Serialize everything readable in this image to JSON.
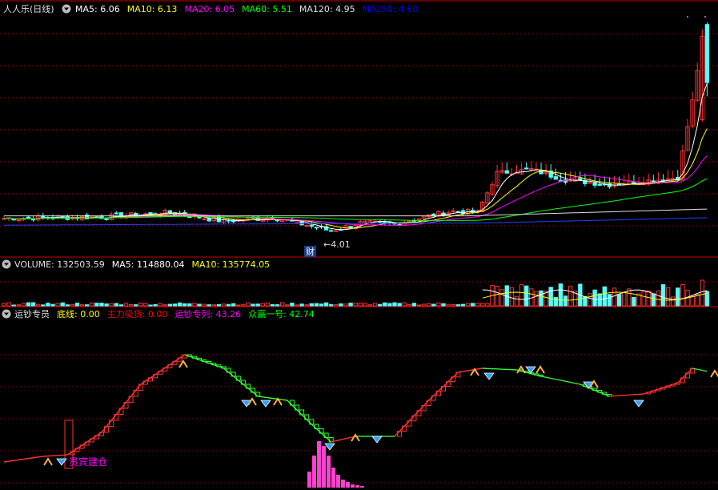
{
  "main_panel": {
    "title": "人人乐(日线)",
    "legend": [
      {
        "name": "MA5",
        "text": "MA5: 6.06",
        "color": "#ffffff"
      },
      {
        "name": "MA10",
        "text": "MA10: 6.13",
        "color": "#ffff00"
      },
      {
        "name": "MA20",
        "text": "MA20: 6.05",
        "color": "#ff00ff"
      },
      {
        "name": "MA60",
        "text": "MA60: 5.51",
        "color": "#00ff00"
      },
      {
        "name": "MA120",
        "text": "MA120: 4.95",
        "color": "#e0e0e0"
      },
      {
        "name": "MA250",
        "text": "MA250: 4.60",
        "color": "#0000ff"
      }
    ],
    "low_label": "←4.01",
    "finance_badge": "财"
  },
  "volume_panel": {
    "legend": [
      {
        "name": "VOLUME",
        "text": "VOLUME: 132503.59",
        "color": "#e0e0e0"
      },
      {
        "name": "MA5",
        "text": "MA5: 114880.04",
        "color": "#ffffff"
      },
      {
        "name": "MA10",
        "text": "MA10: 135774.05",
        "color": "#ffff00"
      }
    ]
  },
  "indicator_panel": {
    "legend": [
      {
        "name": "运钞专员",
        "text": "运钞专员",
        "color": "#e0e0e0"
      },
      {
        "name": "底线",
        "text": "底线: 0.00",
        "color": "#ffff00"
      },
      {
        "name": "主力吸货",
        "text": "主力吸货: 0.00",
        "color": "#ff0000"
      },
      {
        "name": "运钞专列",
        "text": "运钞专列: 43.26",
        "color": "#ff00ff"
      },
      {
        "name": "众赢一号",
        "text": "众赢一号: 42.74",
        "color": "#00ff00"
      }
    ],
    "signal_label": "贵宾建仓"
  },
  "colors": {
    "background": "#000000",
    "grid": "#8b0000",
    "up": "#ff3232",
    "down": "#54fcfc",
    "separator": "#c00000"
  },
  "chart_data": {
    "type": "candlestick",
    "price_range": [
      3.8,
      13.4
    ],
    "low_marker": 4.01,
    "ma_values": {
      "MA5": 6.06,
      "MA10": 6.13,
      "MA20": 6.05,
      "MA60": 5.51,
      "MA120": 4.95,
      "MA250": 4.6
    },
    "volume_values": {
      "VOLUME": 132503.59,
      "MA5": 114880.04,
      "MA10": 135774.05
    },
    "indicator_values": {
      "底线": 0.0,
      "主力吸货": 0.0,
      "运钞专列": 43.26,
      "众赢一号": 42.74
    }
  }
}
